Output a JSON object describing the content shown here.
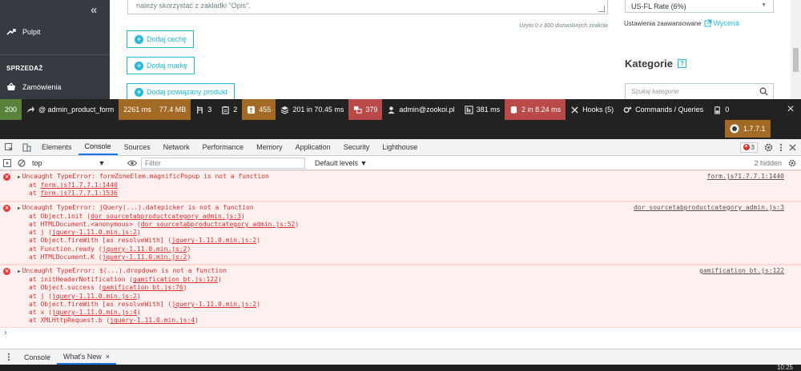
{
  "sidebar": {
    "collapse_glyph": "«",
    "items": [
      {
        "label": "Pulpit",
        "icon": "trending-up-icon"
      },
      {
        "label": "Zamówienia",
        "icon": "basket-icon"
      }
    ],
    "section": "SPRZEDAŻ"
  },
  "product_form": {
    "description_text": "należy skorzystać z zakładki \"Opis\".",
    "char_counter": "Użyto 0 z 800 dozwolonych znaków",
    "buttons": {
      "add_feature": "Dodaj cechę",
      "add_brand": "Dodaj markę",
      "add_related": "Dodaj powiązany produkt"
    }
  },
  "right_panel": {
    "tax_rule": "US-FL Rate (6%)",
    "advanced_settings": "Ustawienia zaawansowane",
    "pricing_link": "Wycena",
    "categories_title": "Kategorie",
    "help_glyph": "?",
    "category_search_placeholder": "Szukaj kategorie"
  },
  "debugbar": {
    "status_code": "200",
    "route": "@ admin_product_form",
    "time": "2261 ms",
    "memory": "77.4 MB",
    "forms_count": "3",
    "validator_count": "2",
    "logs_count": "455",
    "cache": "201 in 70.45 ms",
    "translations_count": "379",
    "user": "admin@zookoi.pl",
    "timeline": "381 ms",
    "db_queries": "2 in 8.24 ms",
    "hooks": "Hooks (5)",
    "commands": "Commands / Queries",
    "modules_count": "0",
    "close_glyph": "×",
    "version": "1.7.7.1",
    "colors": {
      "status": "#59823d",
      "time": "#a26a24",
      "logs": "#a26a24",
      "translations": "#b94a48",
      "db": "#b94a48"
    }
  },
  "devtools": {
    "tabs": [
      "Elements",
      "Console",
      "Sources",
      "Network",
      "Performance",
      "Memory",
      "Application",
      "Security",
      "Lighthouse"
    ],
    "active_tab": "Console",
    "error_count": "3",
    "toolbar": {
      "context": "top",
      "filter_placeholder": "Filter",
      "levels": "Default levels ▼",
      "hidden": "2 hidden"
    },
    "messages": [
      {
        "text": "Uncaught TypeError: formZoneElem.magnificPopup is not a function",
        "source": "form.js?1.7.7.1:1440",
        "frames": [
          {
            "pre": "at ",
            "link": "form.js?1.7.7.1:1440",
            "post": ""
          },
          {
            "pre": "at ",
            "link": "form.js?1.7.7.1:1536",
            "post": ""
          }
        ]
      },
      {
        "text": "Uncaught TypeError: jQuery(...).datepicker is not a function",
        "source": "dor_sourcetabproductcategory_admin.js:3",
        "frames": [
          {
            "pre": "at Object.init (",
            "link": "dor_sourcetabproductcategory_admin.js:3",
            "post": ")"
          },
          {
            "pre": "at HTMLDocument.<anonymous> (",
            "link": "dor_sourcetabproductcategory_admin.js:52",
            "post": ")"
          },
          {
            "pre": "at j (",
            "link": "jquery-1.11.0.min.js:2",
            "post": ")"
          },
          {
            "pre": "at Object.fireWith [as resolveWith] (",
            "link": "jquery-1.11.0.min.js:2",
            "post": ")"
          },
          {
            "pre": "at Function.ready (",
            "link": "jquery-1.11.0.min.js:2",
            "post": ")"
          },
          {
            "pre": "at HTMLDocument.K (",
            "link": "jquery-1.11.0.min.js:2",
            "post": ")"
          }
        ]
      },
      {
        "text": "Uncaught TypeError: $(...).dropdown is not a function",
        "source": "gamification_bt.js:122",
        "frames": [
          {
            "pre": "at initHeaderNotification (",
            "link": "gamification_bt.js:122",
            "post": ")"
          },
          {
            "pre": "at Object.success (",
            "link": "gamification_bt.js:76",
            "post": ")"
          },
          {
            "pre": "at j (",
            "link": "jquery-1.11.0.min.js:2",
            "post": ")"
          },
          {
            "pre": "at Object.fireWith [as resolveWith] (",
            "link": "jquery-1.11.0.min.js:2",
            "post": ")"
          },
          {
            "pre": "at x (",
            "link": "jquery-1.11.0.min.js:4",
            "post": ")"
          },
          {
            "pre": "at XMLHttpRequest.b (",
            "link": "jquery-1.11.0.min.js:4",
            "post": ")"
          }
        ]
      }
    ],
    "prompt_glyph": "›",
    "drawer_tabs": [
      "Console",
      "What's New"
    ],
    "drawer_close": "×"
  },
  "taskbar": {
    "clock": "10:25"
  }
}
